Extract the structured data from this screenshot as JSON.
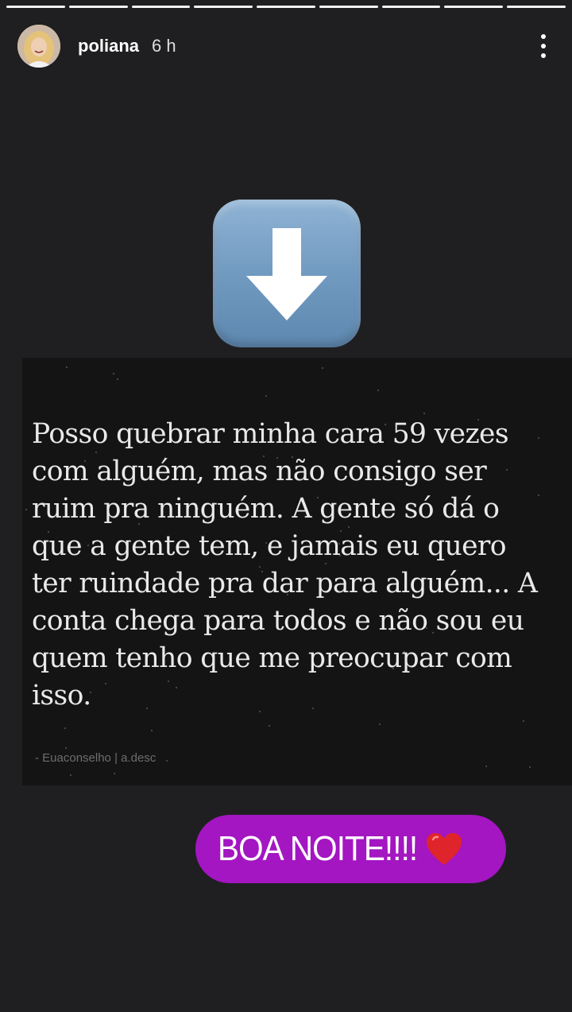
{
  "progress": {
    "segments": 9,
    "active_segment": 9
  },
  "header": {
    "username": "poliana",
    "time": "6 h",
    "avatar_icon": "profile-photo",
    "more_icon": "more-vertical-icon"
  },
  "sticker_arrow": {
    "icon": "down-arrow-emoji",
    "color": "#7aa3c9"
  },
  "quote": {
    "text": "Posso quebrar minha cara 59 vezes\ncom alguém, mas não consigo ser\nruim pra ninguém. A gente só dá o\nque a gente tem, e jamais eu quero\nter ruindade pra dar para alguém... A\nconta chega para todos e não sou eu\nquem tenho que me preocupar com\nisso.",
    "credit": "- Euaconselho | a.desc"
  },
  "goodnight": {
    "text": "BOA NOITE!!!!",
    "icon": "red-heart-emoji",
    "background": "#a316c1"
  }
}
